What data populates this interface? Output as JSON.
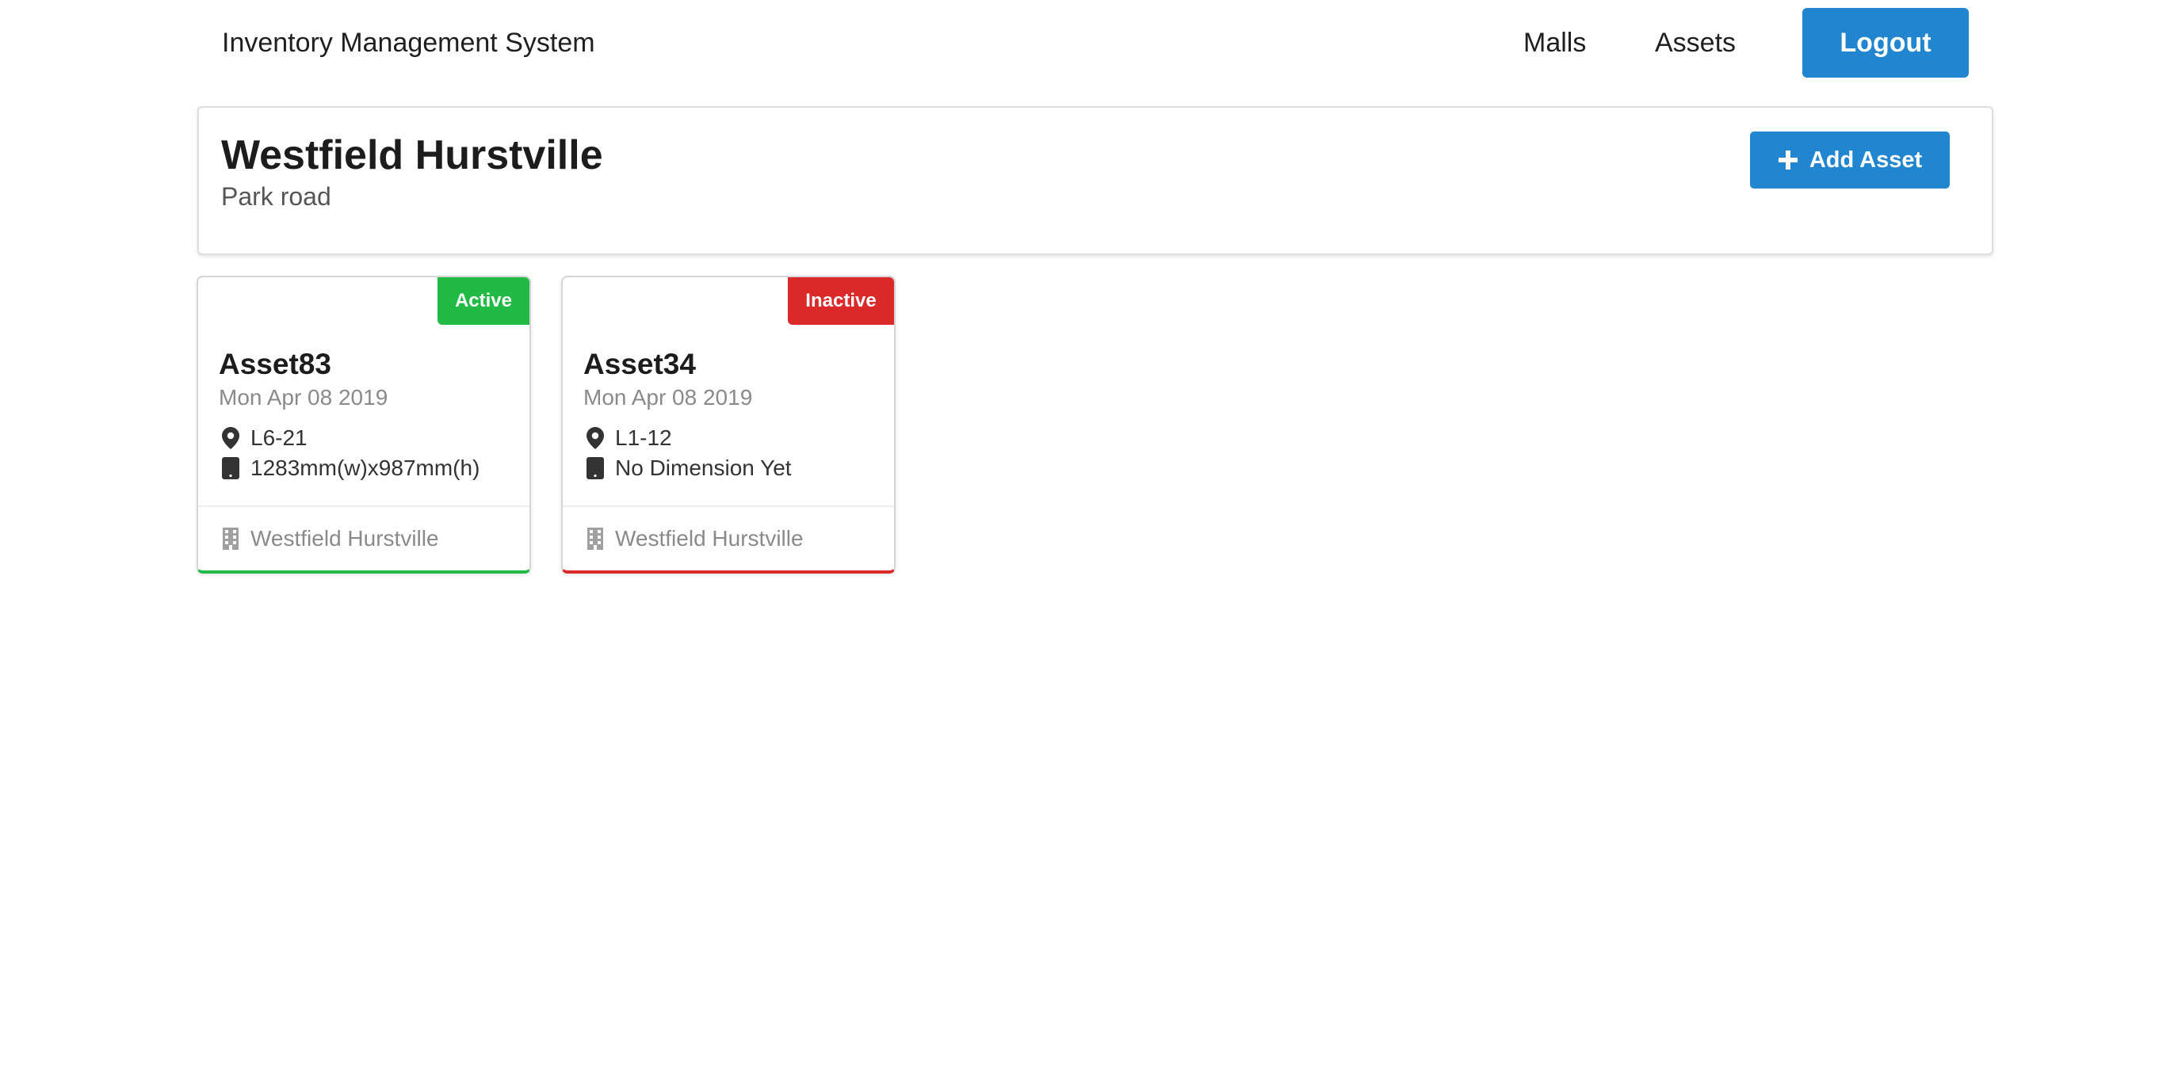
{
  "header": {
    "brand": "Inventory Management System",
    "nav": {
      "malls": "Malls",
      "assets": "Assets"
    },
    "logout_label": "Logout"
  },
  "mall": {
    "name": "Westfield Hurstville",
    "address": "Park road",
    "add_asset_label": "Add Asset"
  },
  "assets": [
    {
      "name": "Asset83",
      "date": "Mon Apr 08 2019",
      "location": "L6-21",
      "dimension": "1283mm(w)x987mm(h)",
      "mall": "Westfield Hurstville",
      "status": "Active"
    },
    {
      "name": "Asset34",
      "date": "Mon Apr 08 2019",
      "location": "L1-12",
      "dimension": "No Dimension Yet",
      "mall": "Westfield Hurstville",
      "status": "Inactive"
    }
  ],
  "colors": {
    "primary": "#2185d0",
    "active": "#21ba45",
    "inactive": "#db2828",
    "muted_text": "#8a8a8a"
  },
  "icons": {
    "add": "plus-icon",
    "location": "map-marker-icon",
    "dimension": "tablet-icon",
    "mall": "building-icon"
  }
}
